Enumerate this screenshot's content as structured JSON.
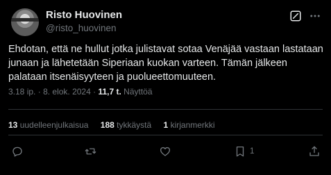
{
  "author": {
    "display_name": "Risto Huovinen",
    "handle": "@risto_huovinen"
  },
  "tweet": {
    "text": "Ehdotan, että ne hullut jotka julistavat sotaa Venäjää vastaan lastataan junaan ja lähetetään Siperiaan kuokan varteen. Tämän jälkeen palataan itsenäisyyteen ja puolueettomuuteen.",
    "time": "3.18 ip.",
    "separator": "·",
    "date": "8. elok. 2024",
    "views_count": "11,7 t.",
    "views_label": "Näyttöä"
  },
  "stats": {
    "reposts_count": "13",
    "reposts_label": "uudelleenjulkaisua",
    "likes_count": "188",
    "likes_label": "tykkäystä",
    "bookmarks_count": "1",
    "bookmarks_label": "kirjanmerkki"
  },
  "actions": {
    "bookmark_count": "1"
  },
  "icons": {
    "grok": "grok-icon",
    "more": "more-icon",
    "reply": "reply-icon",
    "repost": "repost-icon",
    "like": "like-icon",
    "bookmark": "bookmark-icon",
    "share": "share-icon"
  },
  "colors": {
    "background": "#000000",
    "text": "#e7e9ea",
    "muted": "#71767b",
    "divider": "#2f3336"
  }
}
